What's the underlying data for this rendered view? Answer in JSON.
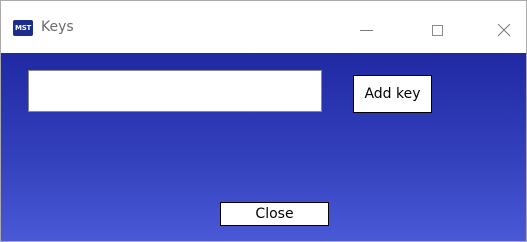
{
  "window": {
    "title": "Keys",
    "app_icon_label": "MST"
  },
  "form": {
    "key_input_value": "",
    "add_key_label": "Add key",
    "close_label": "Close"
  },
  "colors": {
    "client_gradient_top": "#2029a3",
    "client_gradient_bottom": "#4959d6",
    "button_bg": "#ffffff"
  }
}
